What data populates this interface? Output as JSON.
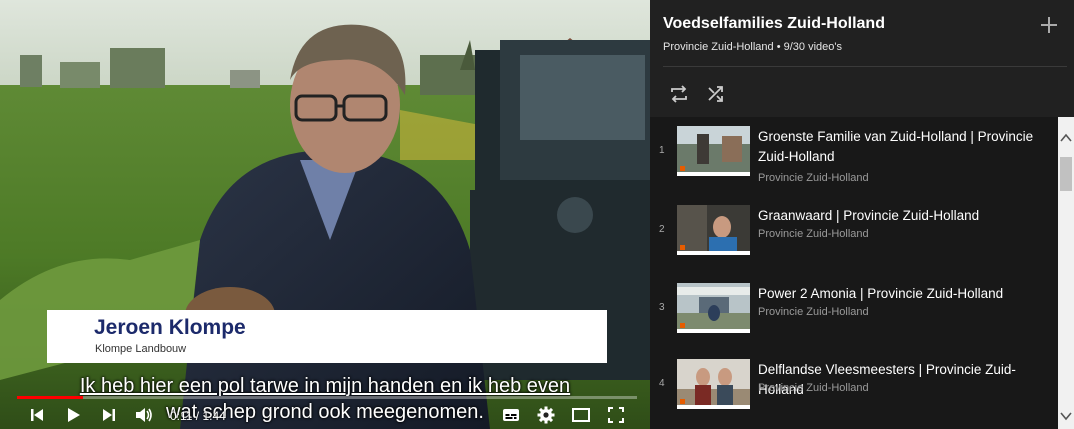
{
  "player": {
    "lower_third": {
      "name": "Jeroen Klompe",
      "company": "Klompe Landbouw"
    },
    "subtitles": {
      "line1": "Ik heb hier een pol tarwe in mijn handen en ik heb even",
      "line2": "wat schep grond ook meegenomen."
    },
    "time": "0:11 / 1:44",
    "progress_fraction": 0.106,
    "controls": [
      "previous-icon",
      "play-icon",
      "next-icon",
      "volume-icon",
      "subtitles-icon",
      "settings-icon",
      "theater-icon",
      "fullscreen-icon"
    ]
  },
  "playlist": {
    "title": "Voedselfamilies Zuid-Holland",
    "meta": "Provincie Zuid-Holland • 9/30 video's",
    "icons": {
      "add": "add-icon",
      "loop": "loop-icon",
      "shuffle": "shuffle-icon"
    },
    "items": [
      {
        "index": "1",
        "title": "Groenste Familie van Zuid-Holland | Provincie Zuid-Holland",
        "channel": "Provincie Zuid-Holland"
      },
      {
        "index": "2",
        "title": "Graanwaard | Provincie Zuid-Holland",
        "channel": "Provincie Zuid-Holland"
      },
      {
        "index": "3",
        "title": "Power 2 Amonia | Provincie Zuid-Holland",
        "channel": "Provincie Zuid-Holland"
      },
      {
        "index": "4",
        "title": "Delflandse Vleesmeesters | Provincie Zuid-Holland",
        "channel": "Provincie Zuid-Holland"
      }
    ]
  },
  "colors": {
    "progress": "#ff0000",
    "panel_bg": "#181818",
    "header_bg": "#212121",
    "lower_third_name": "#1c2a6b"
  }
}
